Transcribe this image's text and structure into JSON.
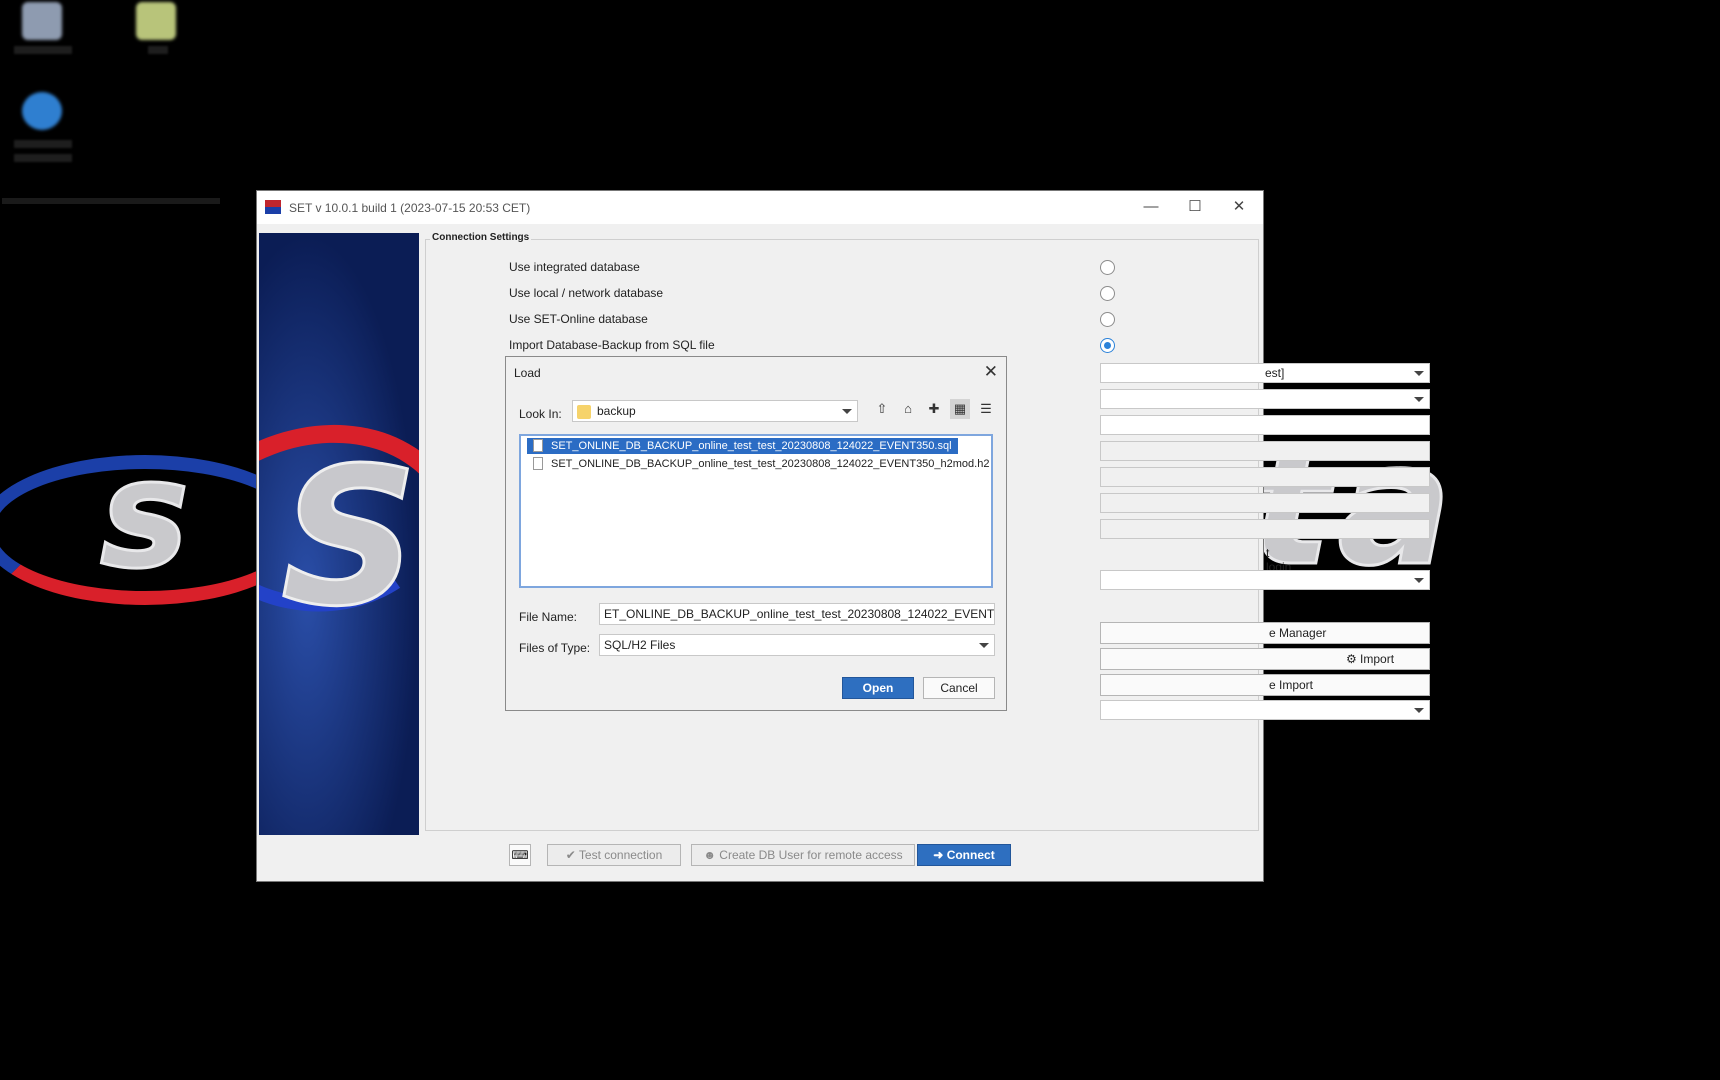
{
  "logo": {
    "left_text": "s",
    "right_text": "ta"
  },
  "window": {
    "title": "SET v 10.0.1 build 1 (2023-07-15 20:53 CET)",
    "group_title": "Connection Settings",
    "options": [
      {
        "label": "Use integrated database",
        "selected": false
      },
      {
        "label": "Use local / network database",
        "selected": false
      },
      {
        "label": "Use SET-Online database",
        "selected": false
      },
      {
        "label": "Import Database-Backup from SQL file",
        "selected": true
      }
    ],
    "peek": {
      "dropdown1_value": "est]",
      "login_label": "t login",
      "manager_button": "e Manager",
      "import_button": "Import",
      "import2_button": "e Import"
    },
    "footer": {
      "test_connection": "Test connection",
      "create_user": "Create DB User for remote access",
      "connect": "Connect"
    }
  },
  "dialog": {
    "title": "Load",
    "look_in_label": "Look In:",
    "look_in_value": "backup",
    "files": [
      {
        "name": "SET_ONLINE_DB_BACKUP_online_test_test_20230808_124022_EVENT350.sql",
        "selected": true
      },
      {
        "name": "SET_ONLINE_DB_BACKUP_online_test_test_20230808_124022_EVENT350_h2mod.h2",
        "selected": false
      }
    ],
    "file_name_label": "File Name:",
    "file_name_value": "ET_ONLINE_DB_BACKUP_online_test_test_20230808_124022_EVENT350.sql",
    "file_type_label": "Files of Type:",
    "file_type_value": "SQL/H2 Files",
    "open_button": "Open",
    "cancel_button": "Cancel"
  },
  "colors": {
    "accent": "#2b6cc4",
    "primary_button": "#2e6fc0",
    "logo_red": "#d9202a",
    "logo_blue": "#1b3fa8"
  }
}
